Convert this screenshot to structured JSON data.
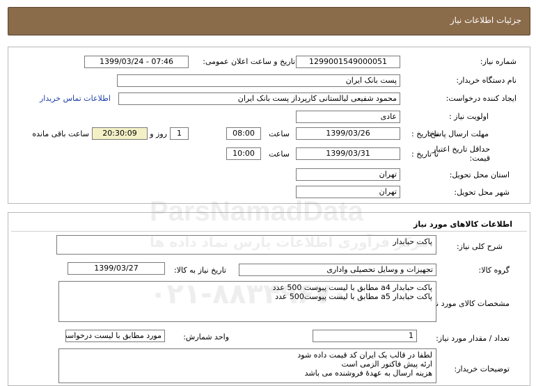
{
  "header": {
    "title": "جزئیات اطلاعات نیاز"
  },
  "need": {
    "number_label": "شماره نیاز:",
    "number_value": "1299001549000051",
    "announce_label": "تاریخ و ساعت اعلان عمومی:",
    "announce_value": "1399/03/24 - 07:46",
    "buyer_org_label": "نام دستگاه خریدار:",
    "buyer_org_value": "پست بانک ایران",
    "creator_label": "ایجاد کننده درخواست:",
    "creator_value": "محمود شفیعی لیالستانی کارپرداز پست بانک ایران",
    "contact_link": "اطلاعات تماس خریدار",
    "priority_label": "اولویت نیاز :",
    "priority_value": "عادی",
    "reply_deadline_label": "مهلت ارسال پاسخ:",
    "to_date_label": "تا تاریخ :",
    "reply_date": "1399/03/26",
    "time_label": "ساعت",
    "reply_time": "08:00",
    "days_value": "1",
    "day_and_label": "روز و",
    "remaining_time": "20:30:09",
    "remaining_label": "ساعت باقی مانده",
    "validity_label": "حداقل تاریخ اعتبار قیمت:",
    "validity_date": "1399/03/31",
    "validity_time": "10:00",
    "province_label": "استان محل تحویل:",
    "province_value": "تهران",
    "city_label": "شهر محل تحویل:",
    "city_value": "تهران"
  },
  "goods": {
    "section_title": "اطلاعات کالاهای مورد نیاز",
    "summary_label": "شرح کلی نیاز:",
    "summary_value": "پاکت حبابدار",
    "group_label": "گروه کالا:",
    "group_value": "تجهیزات و وسایل تحصیلی واداری",
    "need_date_label": "تاریخ نیاز به کالا:",
    "need_date_value": "1399/03/27",
    "specs_label": "مشخصات کالای مورد نیاز:",
    "specs_lines": [
      "پاکت حبابدار a4 مطابق با لیست پیوست 500 عدد",
      "پاکت حبابدار a5 مطابق با لیست پیوست500 عدد"
    ],
    "qty_label": "تعداد / مقدار مورد نیاز:",
    "qty_value": "1",
    "unit_label": "واحد شمارش:",
    "unit_value": "مورد مطابق با لیست درخواست",
    "notes_label": "توضیحات خریدار:",
    "notes_lines": [
      "لطفا در قالب یک ایران کد قیمت داده شود",
      "ارئه پیش فاکتور الزمی است",
      "هزینه ارسال به عهدهٔ فروشنده می باشد"
    ]
  },
  "watermark": {
    "brand": "ParsNamadData",
    "phone": "۰۲۱-۸۸۳۴۹۶۷۰",
    "persian": "مرکز فرآوری اطلاعات پارس نماد داده ها"
  }
}
